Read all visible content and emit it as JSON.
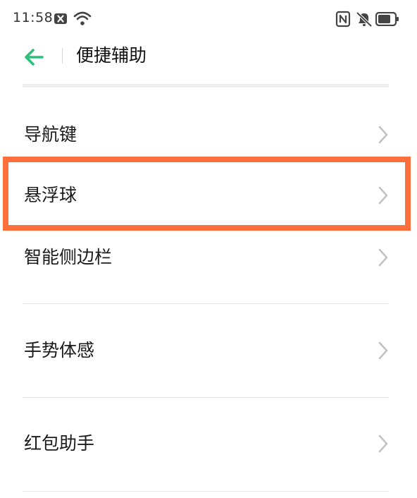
{
  "status_bar": {
    "time": "11:58",
    "icons": [
      "close-badge-icon",
      "wifi-icon",
      "nfc-icon",
      "mute-vibrate-icon",
      "battery-icon"
    ]
  },
  "header": {
    "back_icon": "arrow-left-icon",
    "title": "便捷辅助"
  },
  "menu": {
    "items": [
      {
        "label": "导航键",
        "icon": "chevron-right-icon"
      },
      {
        "label": "悬浮球",
        "icon": "chevron-right-icon"
      },
      {
        "label": "智能侧边栏",
        "icon": "chevron-right-icon"
      },
      {
        "label": "手势体感",
        "icon": "chevron-right-icon"
      },
      {
        "label": "红包助手",
        "icon": "chevron-right-icon"
      }
    ]
  },
  "colors": {
    "accent": "#2bbf7a",
    "highlight": "#ff6f3d",
    "chevron": "#c2c2c2"
  }
}
